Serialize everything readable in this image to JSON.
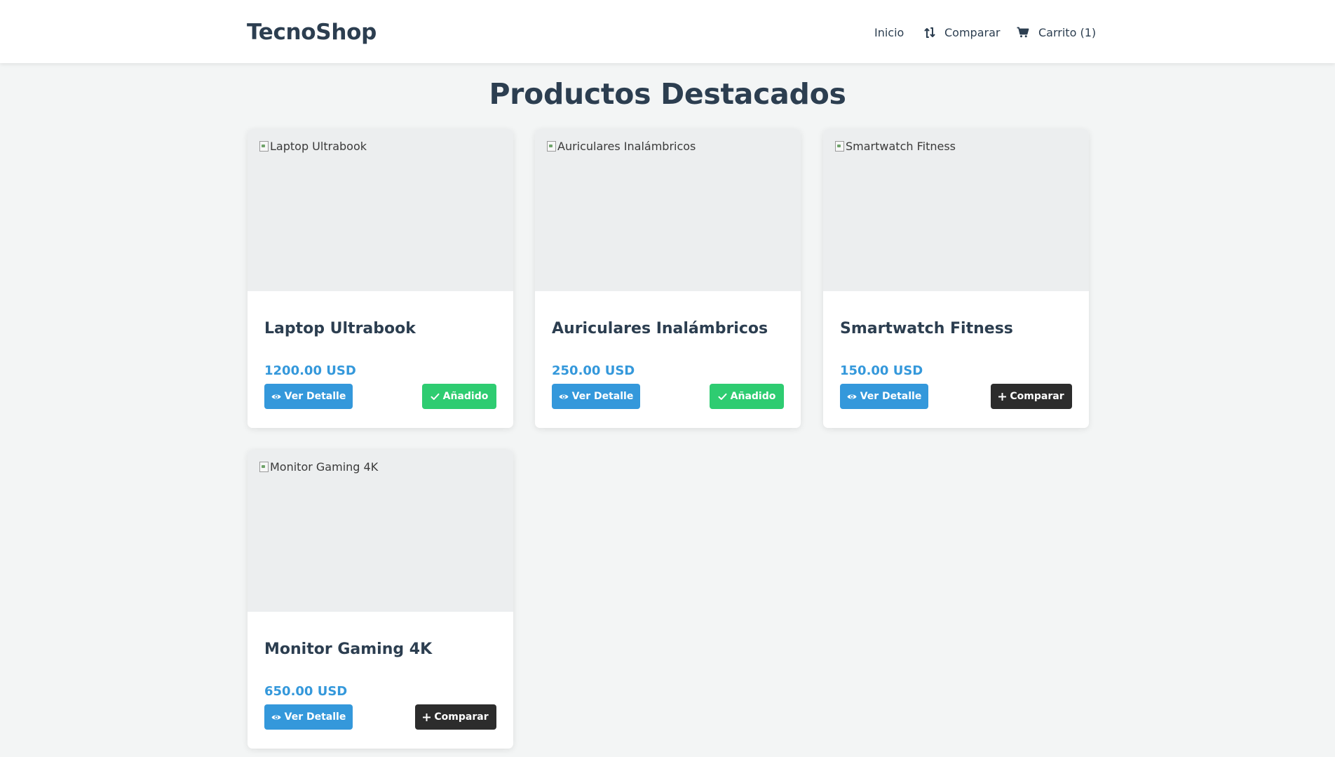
{
  "app": {
    "logo": "TecnoShop"
  },
  "nav": {
    "home_label": "Inicio",
    "compare_label": "Comparar",
    "cart_label": "Carrito (1)"
  },
  "page": {
    "title": "Productos Destacados"
  },
  "products": [
    {
      "name": "Laptop Ultrabook",
      "image_alt": "Laptop Ultrabook",
      "price": "1200.00 USD",
      "detail_label": "Ver Detalle",
      "action_label": "Añadido",
      "action_state": "added"
    },
    {
      "name": "Auriculares Inalámbricos",
      "image_alt": "Auriculares Inalámbricos",
      "price": "250.00 USD",
      "detail_label": "Ver Detalle",
      "action_label": "Añadido",
      "action_state": "added"
    },
    {
      "name": "Smartwatch Fitness",
      "image_alt": "Smartwatch Fitness",
      "price": "150.00 USD",
      "detail_label": "Ver Detalle",
      "action_label": "Comparar",
      "action_state": "compare"
    },
    {
      "name": "Monitor Gaming 4K",
      "image_alt": "Monitor Gaming 4K",
      "price": "650.00 USD",
      "detail_label": "Ver Detalle",
      "action_label": "Comparar",
      "action_state": "compare"
    }
  ],
  "icons": {
    "compare": "compare-arrows-icon",
    "cart": "shopping-cart-icon",
    "detail": "eye-icon",
    "added": "check-icon",
    "add_compare": "plus-icon",
    "broken_image": "broken-image-icon"
  },
  "colors": {
    "primary": "#3498db",
    "success": "#2ecc71",
    "dark": "#2c2c2c",
    "text": "#2c3e50",
    "background": "#f3f5f5"
  }
}
